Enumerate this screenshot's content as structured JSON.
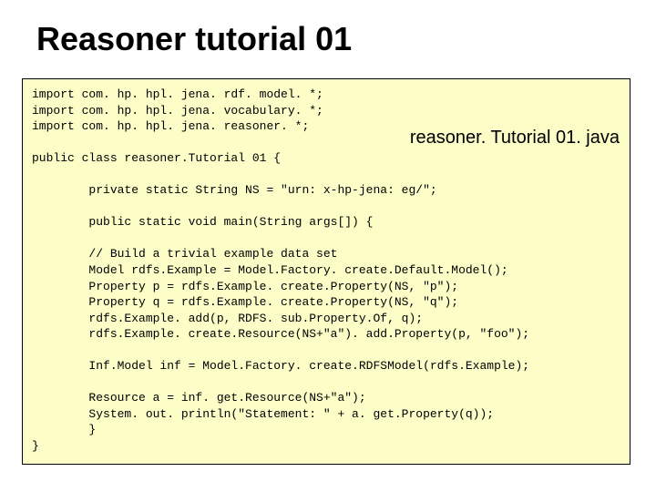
{
  "title": "Reasoner tutorial 01",
  "filename": "reasoner. Tutorial 01. java",
  "code": "import com. hp. hpl. jena. rdf. model. *;\nimport com. hp. hpl. jena. vocabulary. *;\nimport com. hp. hpl. jena. reasoner. *;\n\npublic class reasoner.Tutorial 01 {\n\n        private static String NS = \"urn: x-hp-jena: eg/\";\n\n        public static void main(String args[]) {\n\n        // Build a trivial example data set\n        Model rdfs.Example = Model.Factory. create.Default.Model();\n        Property p = rdfs.Example. create.Property(NS, \"p\");\n        Property q = rdfs.Example. create.Property(NS, \"q\");\n        rdfs.Example. add(p, RDFS. sub.Property.Of, q);\n        rdfs.Example. create.Resource(NS+\"a\"). add.Property(p, \"foo\");\n\n        Inf.Model inf = Model.Factory. create.RDFSModel(rdfs.Example);\n\n        Resource a = inf. get.Resource(NS+\"a\");\n        System. out. println(\"Statement: \" + a. get.Property(q));\n        }\n}"
}
